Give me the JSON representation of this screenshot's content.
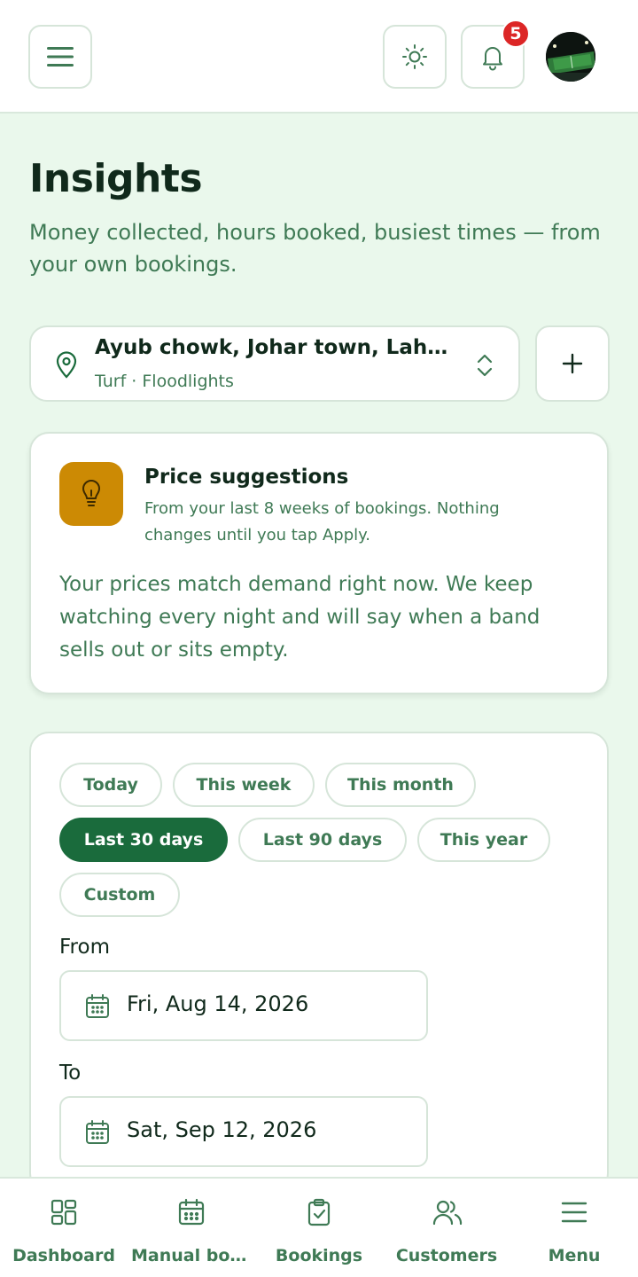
{
  "header": {
    "notification_count": "5"
  },
  "page": {
    "title": "Insights",
    "subtitle": "Money collected, hours booked, busiest times — from your own bookings."
  },
  "location": {
    "name": "Ayub chowk, Johar town, Lahore",
    "meta": "Turf · Floodlights"
  },
  "price_suggestions": {
    "title": "Price suggestions",
    "subtitle": "From your last 8 weeks of bookings. Nothing changes until you tap Apply.",
    "body": "Your prices match demand right now. We keep watching every night and will say when a band sells out or sits empty."
  },
  "range": {
    "chips": [
      {
        "label": "Today",
        "active": false
      },
      {
        "label": "This week",
        "active": false
      },
      {
        "label": "This month",
        "active": false
      },
      {
        "label": "Last 30 days",
        "active": true
      },
      {
        "label": "Last 90 days",
        "active": false
      },
      {
        "label": "This year",
        "active": false
      },
      {
        "label": "Custom",
        "active": false
      }
    ],
    "from_label": "From",
    "from_value": "Fri, Aug 14, 2026",
    "to_label": "To",
    "to_value": "Sat, Sep 12, 2026"
  },
  "nav": [
    {
      "label": "Dashboard",
      "icon": "dashboard-icon"
    },
    {
      "label": "Manual booking",
      "icon": "calendar-icon"
    },
    {
      "label": "Bookings",
      "icon": "clipboard-check-icon"
    },
    {
      "label": "Customers",
      "icon": "users-icon"
    },
    {
      "label": "Menu",
      "icon": "menu-icon"
    }
  ],
  "colors": {
    "accent": "#1a6b3c",
    "background": "#eaf8ec",
    "badge": "#dc2626",
    "bulb_tile": "#cc8a04"
  }
}
